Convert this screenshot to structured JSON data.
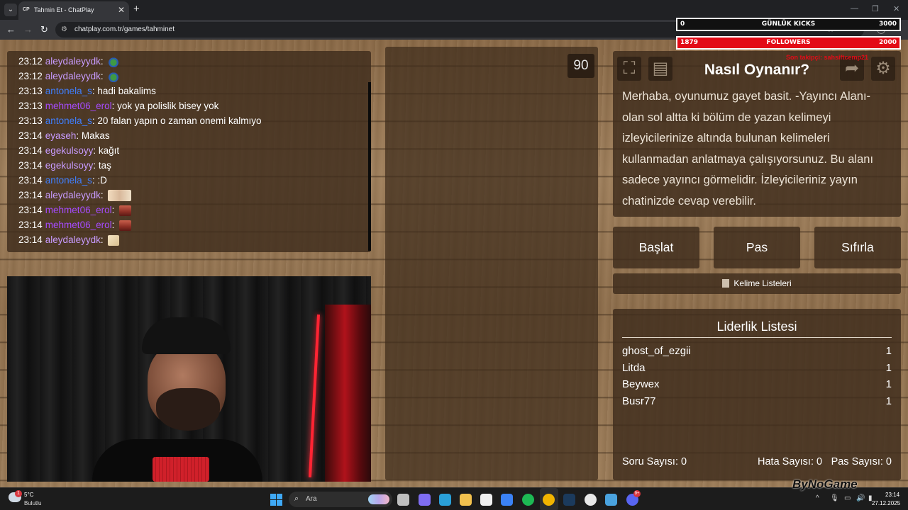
{
  "browser": {
    "tab_list_glyph": "⌄",
    "tab": {
      "favicon": "CP",
      "title": "Tahmin Et - ChatPlay",
      "close": "✕"
    },
    "new_tab": "+",
    "window_controls": {
      "minimize": "—",
      "restore": "❐",
      "close": "✕"
    },
    "nav": {
      "back": "←",
      "forward": "→",
      "reload": "↻"
    },
    "site_info_glyph": "⚙",
    "url": "chatplay.com.tr/games/tahminet",
    "toolbar_icons": {
      "bookmark": "☆",
      "extensions": "⧉",
      "profile": "◯"
    }
  },
  "overlay": {
    "kicks": {
      "left": "0",
      "label": "GÜNLÜK KICKS",
      "right": "3000"
    },
    "followers": {
      "left": "1879",
      "label": "FOLLOWERS",
      "right": "2000"
    },
    "red_text": "Son takipçi: sahsiftcemp21"
  },
  "chat": {
    "messages": [
      {
        "time": "23:12",
        "user": "aleydaleyydk",
        "user_color": "#c89bff",
        "text": "",
        "emote": "pepe"
      },
      {
        "time": "23:12",
        "user": "aleydaleyydk",
        "user_color": "#c89bff",
        "text": "",
        "emote": "pepe"
      },
      {
        "time": "23:13",
        "user": "antonela_s",
        "user_color": "#3f7fff",
        "text": "hadi bakalims",
        "emote": ""
      },
      {
        "time": "23:13",
        "user": "mehmet06_erol",
        "user_color": "#a64bff",
        "text": "yok ya polislik bisey yok",
        "emote": ""
      },
      {
        "time": "23:13",
        "user": "antonela_s",
        "user_color": "#3f7fff",
        "text": "20 falan yapın o zaman onemi kalmıyo",
        "emote": ""
      },
      {
        "time": "23:14",
        "user": "eyaseh",
        "user_color": "#c89bff",
        "text": "Makas",
        "emote": ""
      },
      {
        "time": "23:14",
        "user": "egekulsoyy",
        "user_color": "#c89bff",
        "text": "kağıt",
        "emote": ""
      },
      {
        "time": "23:14",
        "user": "egekulsoyy",
        "user_color": "#c89bff",
        "text": "taş",
        "emote": ""
      },
      {
        "time": "23:14",
        "user": "antonela_s",
        "user_color": "#3f7fff",
        "text": ":D",
        "emote": ""
      },
      {
        "time": "23:14",
        "user": "aleydaleyydk",
        "user_color": "#c89bff",
        "text": "",
        "emote": "cream"
      },
      {
        "time": "23:14",
        "user": "mehmet06_erol",
        "user_color": "#a64bff",
        "text": "",
        "emote": "face"
      },
      {
        "time": "23:14",
        "user": "mehmet06_erol",
        "user_color": "#a64bff",
        "text": "",
        "emote": "face"
      },
      {
        "time": "23:14",
        "user": "aleydaleyydk",
        "user_color": "#c89bff",
        "text": "",
        "emote": "small"
      }
    ]
  },
  "game": {
    "timer": "90",
    "howto": {
      "title": "Nasıl Oynanır?",
      "text": "Merhaba, oyunumuz gayet basit. -Yayıncı Alanı- olan sol altta ki bölüm de yazan kelimeyi izleyicilerinize altında bulunan kelimeleri kullanmadan anlatmaya çalışıyorsunuz. Bu alanı sadece yayıncı görmelidir. İzleyicileriniz yayın chatinizde cevap verebilir.",
      "icons": {
        "fullscreen": "⛶",
        "list": "▤",
        "exit": "➦",
        "settings": "⚙"
      }
    },
    "buttons": {
      "start": "Başlat",
      "pass": "Pas",
      "reset": "Sıfırla"
    },
    "word_lists": "Kelime Listeleri",
    "leaderboard": {
      "title": "Liderlik Listesi",
      "rows": [
        {
          "name": "ghost_of_ezgii",
          "score": "1"
        },
        {
          "name": "Litda",
          "score": "1"
        },
        {
          "name": "Beywex",
          "score": "1"
        },
        {
          "name": "Busr77",
          "score": "1"
        }
      ]
    },
    "stats": {
      "questions": "Soru Sayısı: 0",
      "errors": "Hata Sayısı: 0",
      "passes": "Pas Sayısı: 0"
    }
  },
  "watermark": "ByNoGame",
  "taskbar": {
    "weather": {
      "badge": "1",
      "temp": "5°C",
      "desc": "Bulutlu"
    },
    "search_icon": "⌕",
    "search_placeholder": "Ara",
    "apps": [
      {
        "name": "task-view",
        "color": "#bfbfbf"
      },
      {
        "name": "copilot",
        "color": "#7f6df2"
      },
      {
        "name": "edge",
        "color": "#2aa0d8"
      },
      {
        "name": "file-explorer",
        "color": "#f2c14e"
      },
      {
        "name": "store",
        "color": "#f0f0f0"
      },
      {
        "name": "mail",
        "color": "#3b82f6"
      },
      {
        "name": "spotify",
        "color": "#1db954"
      },
      {
        "name": "chrome",
        "color": "#f2b400"
      },
      {
        "name": "steam",
        "color": "#1b3a5c"
      },
      {
        "name": "obs",
        "color": "#e8e8e8"
      },
      {
        "name": "app-extra",
        "color": "#4aa3df"
      },
      {
        "name": "discord",
        "color": "#5865f2"
      }
    ],
    "discord_badge": "9+",
    "tray": {
      "chevron": "^",
      "mic": "🎙",
      "display": "▭",
      "volume": "🔊",
      "battery": "▮"
    },
    "time": "23:14",
    "date": "27.12.2025"
  }
}
